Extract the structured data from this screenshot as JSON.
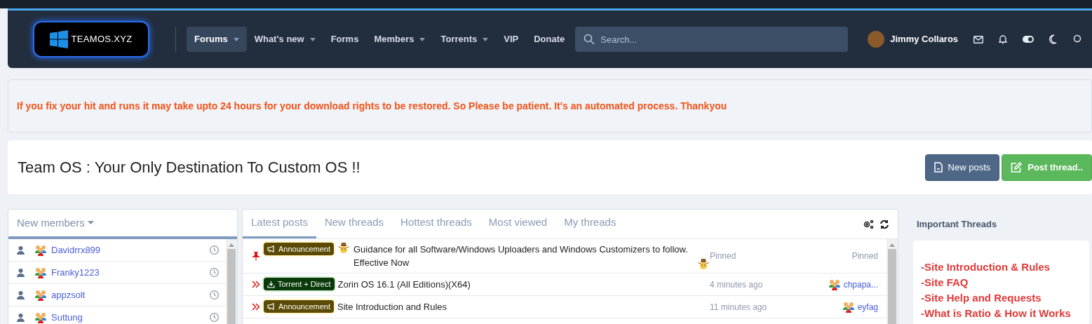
{
  "header": {
    "logo": "TEAMOS.XYZ",
    "nav": [
      {
        "label": "Forums",
        "selected": true,
        "dropdown": true
      },
      {
        "label": "What's new",
        "selected": false,
        "dropdown": true
      },
      {
        "label": "Forms",
        "selected": false,
        "dropdown": false
      },
      {
        "label": "Members",
        "selected": false,
        "dropdown": true
      },
      {
        "label": "Torrents",
        "selected": false,
        "dropdown": true
      },
      {
        "label": "VIP",
        "selected": false,
        "dropdown": false
      },
      {
        "label": "Donate",
        "selected": false,
        "dropdown": false
      }
    ],
    "search": {
      "placeholder": "Search..."
    },
    "user": {
      "name": "Jimmy Collaros"
    }
  },
  "notice": "If you fix your hit and runs it may take upto 24 hours for your download rights to be restored. So Please be patient. It's an automated process. Thankyou",
  "page_title": "Team OS : Your Only Destination To Custom OS !!",
  "buttons": [
    {
      "label": "New posts",
      "kind": "secondary"
    },
    {
      "label": "Post thread..",
      "kind": "primary"
    }
  ],
  "new_members": {
    "title": "New members",
    "members": [
      "Davidrrx899",
      "Franky1223",
      "appzsolt",
      "Suttung"
    ]
  },
  "latest": {
    "tabs": [
      {
        "label": "Latest posts",
        "selected": true
      },
      {
        "label": "New threads",
        "selected": false
      },
      {
        "label": "Hottest threads",
        "selected": false
      },
      {
        "label": "Most viewed",
        "selected": false
      },
      {
        "label": "My threads",
        "selected": false
      }
    ],
    "threads": [
      {
        "pinned": true,
        "prefix": {
          "label": "Announcement",
          "kind": "announcement"
        },
        "emoji": true,
        "title": "Guidance for all Software/Windows Uploaders and Windows Customizers to follow. Effective Now",
        "time": "Pinned",
        "author": "Pinned",
        "author_link": false
      },
      {
        "pinned": false,
        "prefix": {
          "label": "Torrent + Direct",
          "kind": "torrent"
        },
        "emoji": false,
        "title": "Zorin OS 16.1 (All Editions)(X64)",
        "time": "4 minutes ago",
        "author": "chpapa...",
        "author_link": true
      },
      {
        "pinned": false,
        "prefix": {
          "label": "Announcement",
          "kind": "announcement"
        },
        "emoji": false,
        "title": "Site Introduction and Rules",
        "time": "11 minutes ago",
        "author": "eyfag",
        "author_link": true
      }
    ]
  },
  "important": {
    "title": "Important Threads",
    "links": [
      "-Site Introduction & Rules",
      "-Site FAQ",
      "-Site Help and Requests",
      "-What is Ratio & How it Works"
    ]
  }
}
